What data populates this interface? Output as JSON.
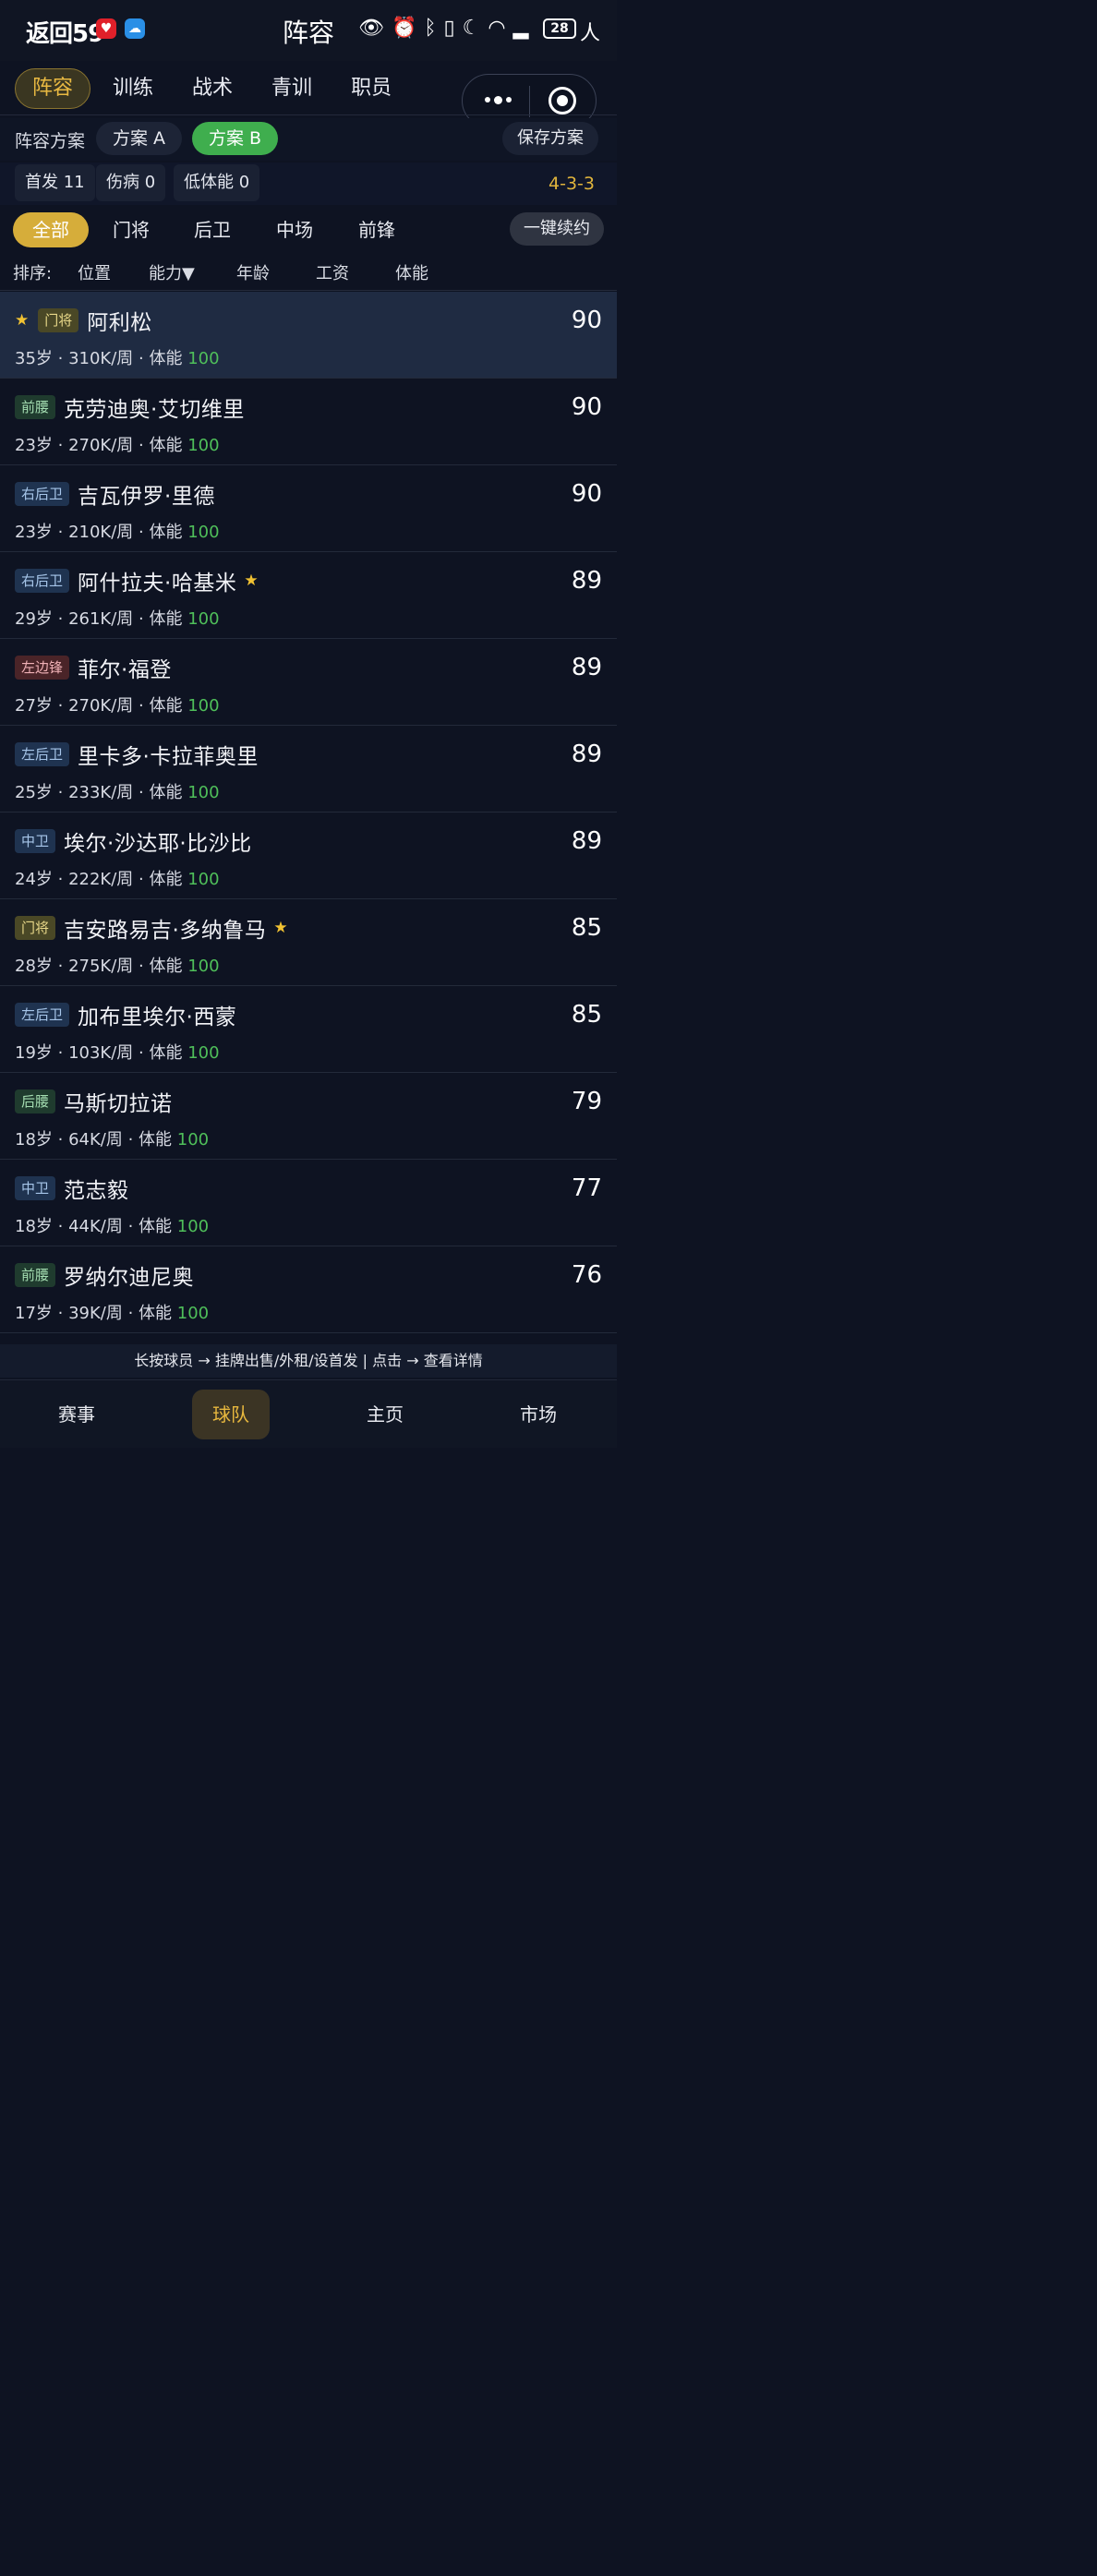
{
  "status_bar": {
    "time": "返回59",
    "title": "阵容",
    "battery": "28",
    "icons": [
      "eye-icon",
      "alarm-icon",
      "bluetooth-icon",
      "vibrate-icon",
      "moon-icon",
      "wifi-icon",
      "signal-icon"
    ],
    "extra": "人"
  },
  "top_tabs": [
    {
      "label": "阵容",
      "active": true
    },
    {
      "label": "训练",
      "active": false
    },
    {
      "label": "战术",
      "active": false
    },
    {
      "label": "青训",
      "active": false
    },
    {
      "label": "职员",
      "active": false
    }
  ],
  "plan": {
    "label": "阵容方案",
    "options": [
      {
        "label": "方案 A",
        "active": false
      },
      {
        "label": "方案 B",
        "active": true
      }
    ],
    "save_label": "保存方案"
  },
  "stats": {
    "starters": "首发 11",
    "injured": "伤病 0",
    "low_stamina": "低体能 0",
    "formation": "4-3-3"
  },
  "filters": {
    "tabs": [
      {
        "label": "全部",
        "active": true
      },
      {
        "label": "门将",
        "active": false
      },
      {
        "label": "后卫",
        "active": false
      },
      {
        "label": "中场",
        "active": false
      },
      {
        "label": "前锋",
        "active": false
      }
    ],
    "renew_label": "一键续约"
  },
  "sort": {
    "label": "排序:",
    "options": [
      "位置",
      "能力▼",
      "年龄",
      "工资",
      "体能"
    ]
  },
  "players": [
    {
      "pos": "门将",
      "name": "阿利松",
      "age": "35岁",
      "wage": "310K/周",
      "stamina_label": "体能",
      "stamina": "100",
      "rating": "90",
      "star": "before",
      "selected": true
    },
    {
      "pos": "前腰",
      "name": "克劳迪奥·艾切维里",
      "age": "23岁",
      "wage": "270K/周",
      "stamina_label": "体能",
      "stamina": "100",
      "rating": "90",
      "star": "none",
      "selected": false
    },
    {
      "pos": "右后卫",
      "name": "吉瓦伊罗·里德",
      "age": "23岁",
      "wage": "210K/周",
      "stamina_label": "体能",
      "stamina": "100",
      "rating": "90",
      "star": "none",
      "selected": false
    },
    {
      "pos": "右后卫",
      "name": "阿什拉夫·哈基米",
      "age": "29岁",
      "wage": "261K/周",
      "stamina_label": "体能",
      "stamina": "100",
      "rating": "89",
      "star": "after",
      "selected": false
    },
    {
      "pos": "左边锋",
      "name": "菲尔·福登",
      "age": "27岁",
      "wage": "270K/周",
      "stamina_label": "体能",
      "stamina": "100",
      "rating": "89",
      "star": "none",
      "selected": false
    },
    {
      "pos": "左后卫",
      "name": "里卡多·卡拉菲奥里",
      "age": "25岁",
      "wage": "233K/周",
      "stamina_label": "体能",
      "stamina": "100",
      "rating": "89",
      "star": "none",
      "selected": false
    },
    {
      "pos": "中卫",
      "name": "埃尔·沙达耶·比沙比",
      "age": "24岁",
      "wage": "222K/周",
      "stamina_label": "体能",
      "stamina": "100",
      "rating": "89",
      "star": "none",
      "selected": false
    },
    {
      "pos": "门将",
      "name": "吉安路易吉·多纳鲁马",
      "age": "28岁",
      "wage": "275K/周",
      "stamina_label": "体能",
      "stamina": "100",
      "rating": "85",
      "star": "after",
      "selected": false
    },
    {
      "pos": "左后卫",
      "name": "加布里埃尔·西蒙",
      "age": "19岁",
      "wage": "103K/周",
      "stamina_label": "体能",
      "stamina": "100",
      "rating": "85",
      "star": "none",
      "selected": false
    },
    {
      "pos": "后腰",
      "name": "马斯切拉诺",
      "age": "18岁",
      "wage": "64K/周",
      "stamina_label": "体能",
      "stamina": "100",
      "rating": "79",
      "star": "none",
      "selected": false
    },
    {
      "pos": "中卫",
      "name": "范志毅",
      "age": "18岁",
      "wage": "44K/周",
      "stamina_label": "体能",
      "stamina": "100",
      "rating": "77",
      "star": "none",
      "selected": false
    },
    {
      "pos": "前腰",
      "name": "罗纳尔迪尼奥",
      "age": "17岁",
      "wage": "39K/周",
      "stamina_label": "体能",
      "stamina": "100",
      "rating": "76",
      "star": "none",
      "selected": false
    }
  ],
  "hint": "长按球员 → 挂牌出售/外租/设首发 | 点击 → 查看详情",
  "bottom_nav": [
    {
      "label": "赛事",
      "active": false
    },
    {
      "label": "球队",
      "active": true
    },
    {
      "label": "主页",
      "active": false
    },
    {
      "label": "市场",
      "active": false
    }
  ],
  "colors": {
    "background": "#0e1322",
    "gold_accent": "#d6ad3a",
    "green_accent": "#3fae4e",
    "stamina_green": "#4fbf5a",
    "star_yellow": "#f1c232"
  }
}
